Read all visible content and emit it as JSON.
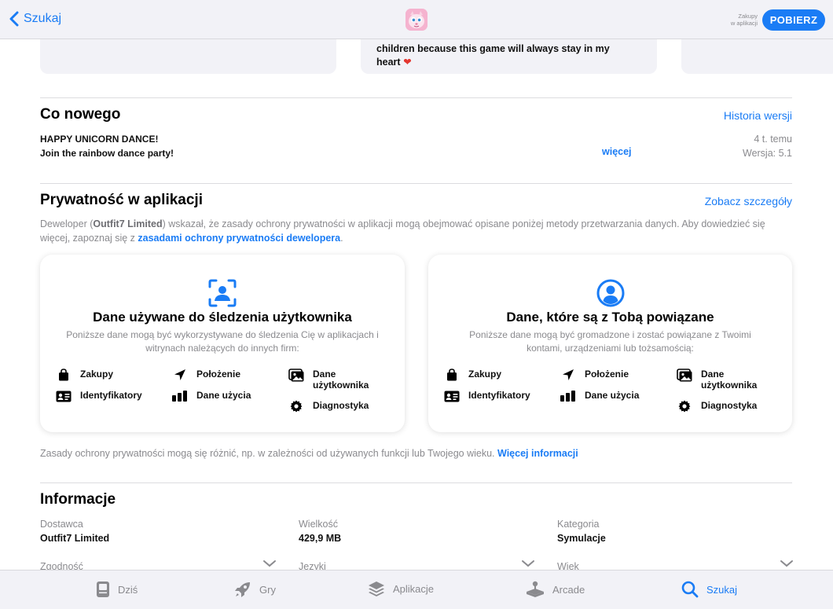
{
  "topbar": {
    "back_label": "Szukaj",
    "in_app_purchases": [
      "Zakupy",
      "w aplikacji"
    ],
    "get_label": "POBIERZ"
  },
  "review": {
    "text_line1": "children because this game will always stay in my",
    "text_line2": "heart",
    "emoji": "❤️"
  },
  "whats_new": {
    "title": "Co nowego",
    "history_link": "Historia wersji",
    "notes": [
      "HAPPY UNICORN DANCE!",
      "Join the rainbow dance party!"
    ],
    "more_link": "więcej",
    "time_ago": "4 t. temu",
    "version": "Wersja: 5.1"
  },
  "privacy": {
    "title": "Prywatność w aplikacji",
    "details_link": "Zobacz szczegóły",
    "desc_prefix": "Deweloper (",
    "developer": "Outfit7 Limited",
    "desc_middle": ") wskazał, że zasady ochrony prywatności w aplikacji mogą obejmować opisane poniżej metody przetwarzania danych. Aby dowiedzieć się więcej, zapoznaj się z ",
    "policy_link": "zasadami ochrony prywatności dewelopera",
    "desc_suffix": ".",
    "cards": [
      {
        "title": "Dane używane do śledzenia użytkownika",
        "subtitle": "Poniższe dane mogą być wykorzystywane do śledzenia Cię w aplikacjach i witrynach należących do innych firm:",
        "items": [
          "Zakupy",
          "Identyfikatory",
          "Położenie",
          "Dane użycia",
          "Dane użytkownika",
          "Diagnostyka"
        ]
      },
      {
        "title": "Dane, które są z Tobą powiązane",
        "subtitle": "Poniższe dane mogą być gromadzone i zostać powiązane z Twoimi kontami, urządzeniami lub tożsamością:",
        "items": [
          "Zakupy",
          "Identyfikatory",
          "Położenie",
          "Dane użycia",
          "Dane użytkownika",
          "Diagnostyka"
        ]
      }
    ],
    "note": "Zasady ochrony prywatności mogą się różnić, np. w zależności od używanych funkcji lub Twojego wieku.",
    "note_link": "Więcej informacji"
  },
  "information": {
    "title": "Informacje",
    "rows": [
      {
        "label": "Dostawca",
        "value": "Outfit7 Limited"
      },
      {
        "label": "Wielkość",
        "value": "429,9 MB"
      },
      {
        "label": "Kategoria",
        "value": "Symulacje"
      }
    ],
    "expandable": [
      "Zgodność",
      "Języki",
      "Wiek"
    ]
  },
  "tabbar": {
    "tabs": [
      "Dziś",
      "Gry",
      "Aplikacje",
      "Arcade",
      "Szukaj"
    ],
    "active": "Szukaj"
  },
  "colors": {
    "accent": "#1a7cf5",
    "secondary_text": "#8a8a8e",
    "bar_background": "#f2f2f7"
  }
}
